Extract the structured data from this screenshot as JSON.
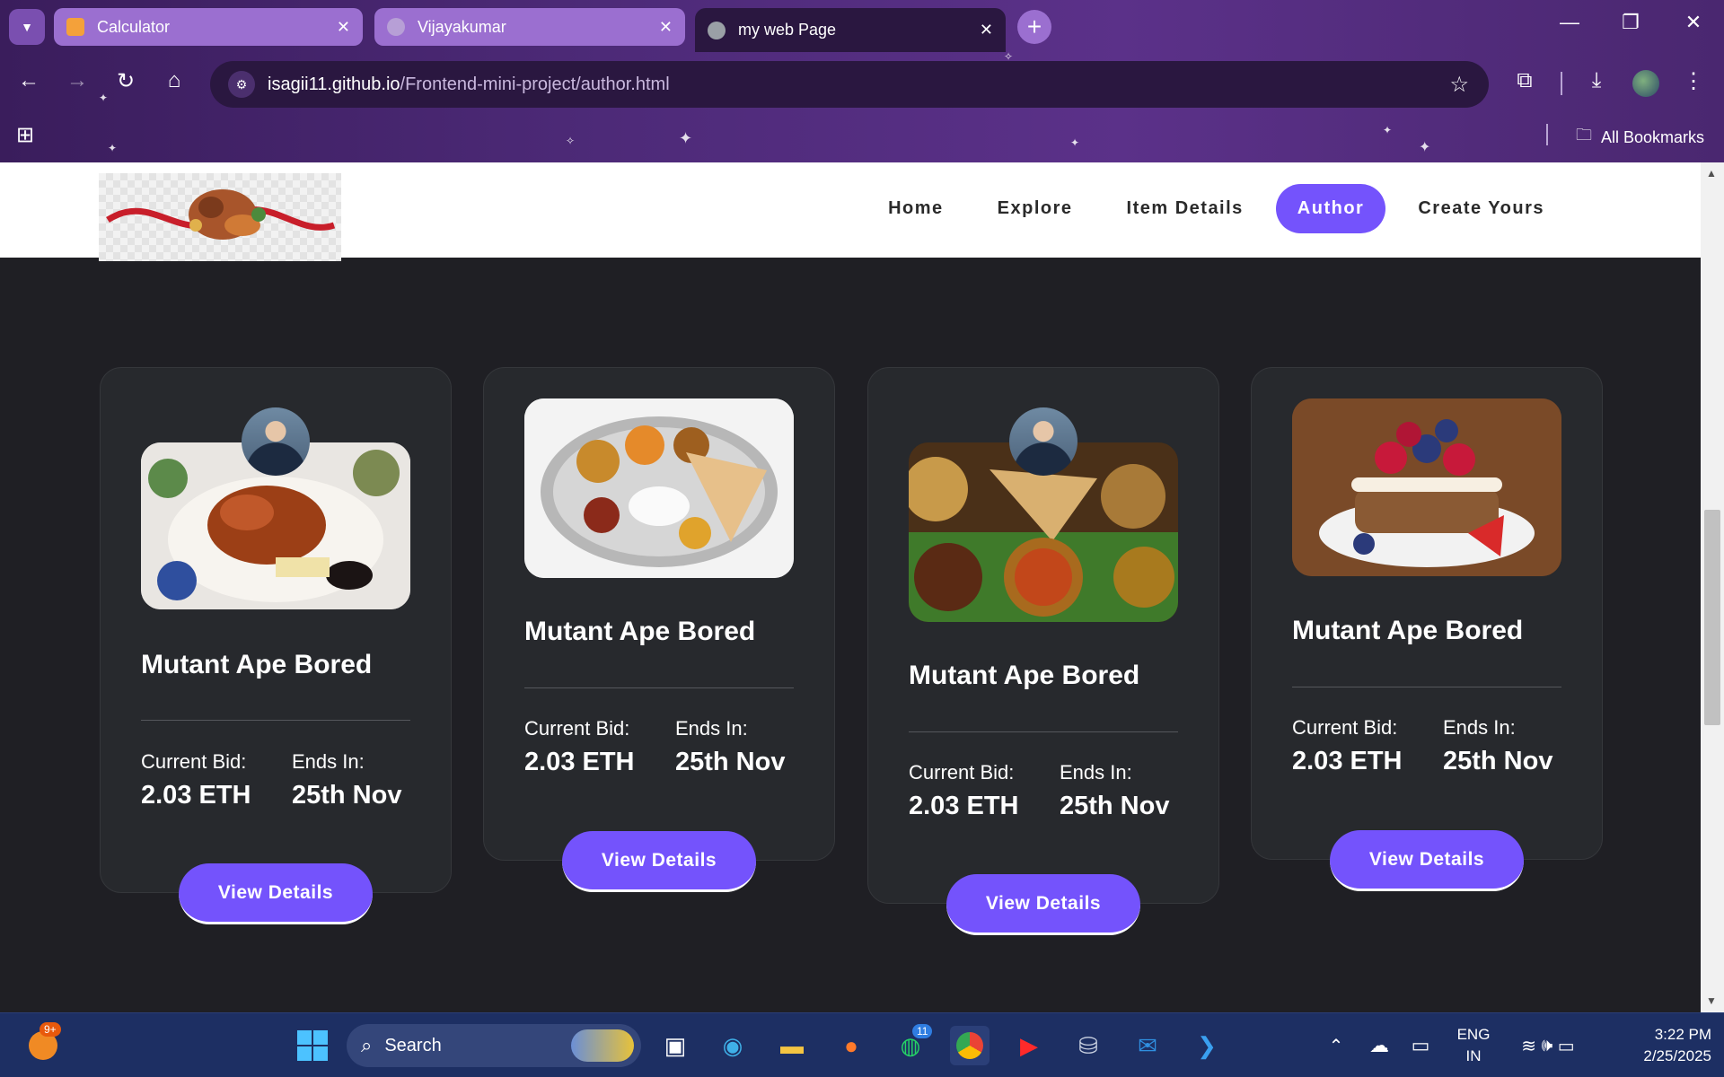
{
  "browser": {
    "tabs": [
      {
        "title": "Calculator",
        "favicon_color": "#f4a13a",
        "active": false
      },
      {
        "title": "Vijayakumar",
        "favicon_color": "#b79fd6",
        "active": false
      },
      {
        "title": "my web Page",
        "favicon_color": "#9aa0a6",
        "active": true
      }
    ],
    "url_host": "isagii11.github.io",
    "url_path": "/Frontend-mini-project/author.html",
    "bookmarks_label": "All Bookmarks",
    "icons": [
      "tab-search-icon",
      "back-icon",
      "forward-icon",
      "reload-icon",
      "home-icon",
      "site-info-icon",
      "star-icon",
      "extensions-icon",
      "download-icon",
      "menu-icon",
      "apps-icon",
      "folder-icon",
      "minimize-icon",
      "restore-icon",
      "close-icon"
    ]
  },
  "site": {
    "nav": [
      "Home",
      "Explore",
      "Item Details",
      "Author",
      "Create Yours"
    ],
    "active_nav": "Author",
    "accent": "#7453fc"
  },
  "cards": [
    {
      "title": "Mutant Ape Bored",
      "bid_label": "Current Bid:",
      "bid_value": "2.03 ETH",
      "ends_label": "Ends In:",
      "ends_value": "25th Nov",
      "button": "View Details",
      "image": "roast-duck-platter",
      "has_avatar": true
    },
    {
      "title": "Mutant Ape Bored",
      "bid_label": "Current Bid:",
      "bid_value": "2.03 ETH",
      "ends_label": "Ends In:",
      "ends_value": "25th Nov",
      "button": "View Details",
      "image": "indian-thali-plate",
      "has_avatar": false
    },
    {
      "title": "Mutant Ape Bored",
      "bid_label": "Current Bid:",
      "bid_value": "2.03 ETH",
      "ends_label": "Ends In:",
      "ends_value": "25th Nov",
      "button": "View Details",
      "image": "curry-spread",
      "has_avatar": true
    },
    {
      "title": "Mutant Ape Bored",
      "bid_label": "Current Bid:",
      "bid_value": "2.03 ETH",
      "ends_label": "Ends In:",
      "ends_value": "25th Nov",
      "button": "View Details",
      "image": "berry-pancake-stack",
      "has_avatar": false
    }
  ],
  "taskbar": {
    "badge": "9+",
    "search_placeholder": "Search",
    "whatsapp_badge": "11",
    "lang_top": "ENG",
    "lang_bottom": "IN",
    "time": "3:22 PM",
    "date": "2/25/2025"
  }
}
